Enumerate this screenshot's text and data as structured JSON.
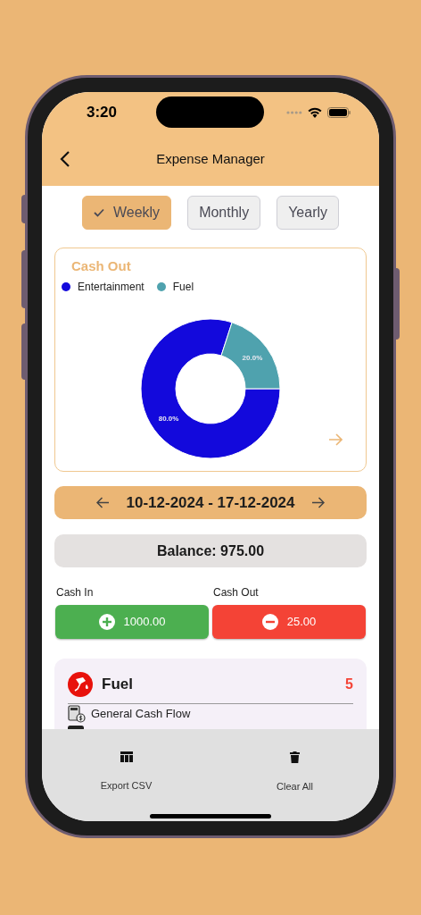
{
  "status_bar": {
    "time": "3:20"
  },
  "header": {
    "title": "Expense Manager"
  },
  "period_tabs": [
    {
      "label": "Weekly",
      "selected": true
    },
    {
      "label": "Monthly",
      "selected": false
    },
    {
      "label": "Yearly",
      "selected": false
    }
  ],
  "chart_card": {
    "title": "Cash Out",
    "legend": [
      {
        "color": "#1309dc"
      },
      {
        "color": "#4fa2ae"
      }
    ],
    "chart_data": {
      "type": "donut",
      "categories": [
        "Entertainment",
        "Fuel"
      ],
      "values": [
        80,
        20
      ],
      "value_labels": [
        "80.0%",
        "20.0%"
      ]
    }
  },
  "date_range": {
    "label": "10-12-2024 - 17-12-2024"
  },
  "balance": {
    "label": "Balance: 975.00"
  },
  "cash_in": {
    "label": "Cash In",
    "amount": "1000.00"
  },
  "cash_out": {
    "label": "Cash Out",
    "amount": "25.00"
  },
  "transactions": [
    {
      "category": "Fuel",
      "amount": "5",
      "account": "General Cash Flow"
    }
  ],
  "bottom_actions": [
    {
      "label": "Export CSV",
      "kind": "export"
    },
    {
      "label": "Clear All",
      "kind": "clear"
    }
  ]
}
